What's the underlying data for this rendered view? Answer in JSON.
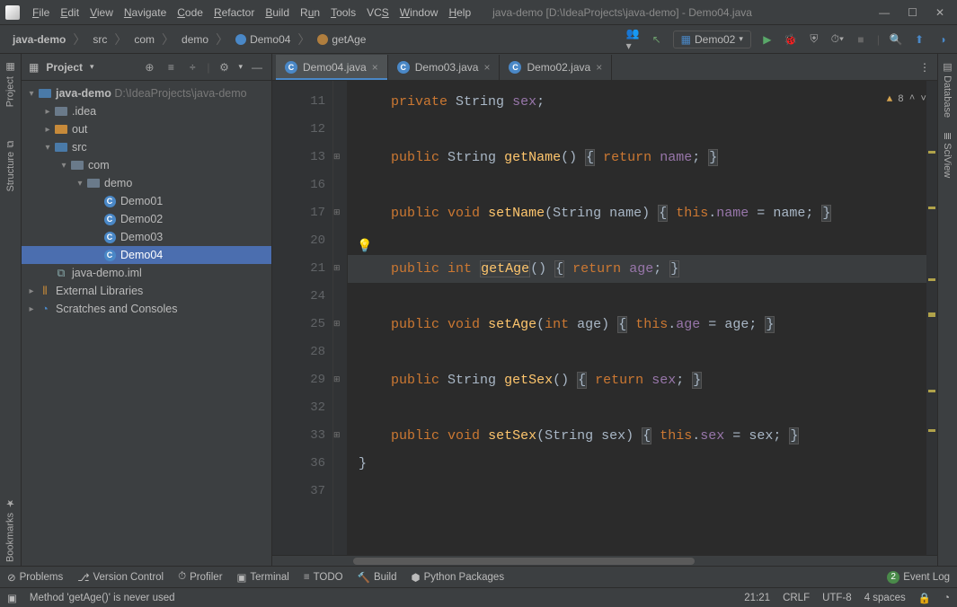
{
  "title": "java-demo [D:\\IdeaProjects\\java-demo] - Demo04.java",
  "menu": [
    "File",
    "Edit",
    "View",
    "Navigate",
    "Code",
    "Refactor",
    "Build",
    "Run",
    "Tools",
    "VCS",
    "Window",
    "Help"
  ],
  "breadcrumb": {
    "p0": "java-demo",
    "p1": "src",
    "p2": "com",
    "p3": "demo",
    "p4": "Demo04",
    "p5": "getAge"
  },
  "runConfig": "Demo02",
  "projectPanel": {
    "title": "Project",
    "root": "java-demo",
    "rootHint": "D:\\IdeaProjects\\java-demo",
    "n_idea": ".idea",
    "n_out": "out",
    "n_src": "src",
    "n_com": "com",
    "n_demo": "demo",
    "n_d1": "Demo01",
    "n_d2": "Demo02",
    "n_d3": "Demo03",
    "n_d4": "Demo04",
    "n_iml": "java-demo.iml",
    "n_ext": "External Libraries",
    "n_scr": "Scratches and Consoles"
  },
  "tabs": {
    "t0": "Demo04.java",
    "t1": "Demo03.java",
    "t2": "Demo02.java"
  },
  "gutterLines": [
    "11",
    "12",
    "13",
    "16",
    "17",
    "20",
    "21",
    "24",
    "25",
    "28",
    "29",
    "32",
    "33",
    "36",
    "37"
  ],
  "inspections": {
    "warn": "8"
  },
  "code": {
    "kw_private": "private",
    "kw_public": "public",
    "kw_return": "return",
    "kw_this": "this",
    "kw_void": "void",
    "kw_int": "int",
    "t_String": "String",
    "v_sex": "sex",
    "v_name": "name",
    "v_age": "age",
    "m_getName": "getName",
    "m_setName": "setName",
    "m_getAge": "getAge",
    "m_setAge": "setAge",
    "m_getSex": "getSex",
    "m_setSex": "setSex"
  },
  "leftTabs": {
    "t0": "Project",
    "t1": "Structure",
    "t2": "Bookmarks"
  },
  "rightTabs": {
    "t0": "Database",
    "t1": "SciView"
  },
  "bottom": {
    "problems": "Problems",
    "vcs": "Version Control",
    "profiler": "Profiler",
    "terminal": "Terminal",
    "todo": "TODO",
    "build": "Build",
    "pypkg": "Python Packages",
    "eventlog": "Event Log",
    "eventcount": "2"
  },
  "status": {
    "msg": "Method 'getAge()' is never used",
    "pos": "21:21",
    "le": "CRLF",
    "enc": "UTF-8",
    "indent": "4 spaces"
  }
}
